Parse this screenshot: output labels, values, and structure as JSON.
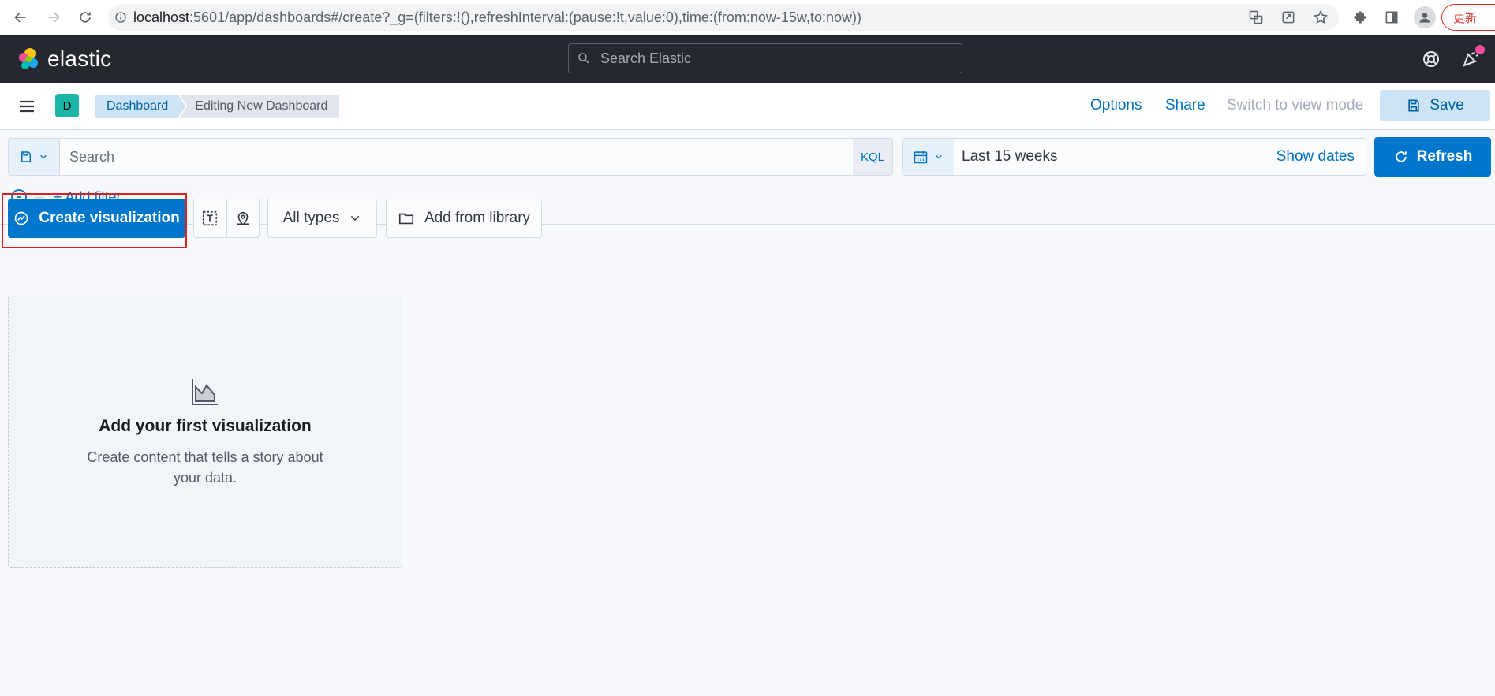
{
  "browser": {
    "url_host": "localhost",
    "url_rest": ":5601/app/dashboards#/create?_g=(filters:!(),refreshInterval:(pause:!t,value:0),time:(from:now-15w,to:now))",
    "update_label": "更新"
  },
  "header": {
    "logo_text": "elastic",
    "search_placeholder": "Search Elastic"
  },
  "app_header": {
    "space_initial": "D",
    "breadcrumbs": [
      "Dashboard",
      "Editing New Dashboard"
    ],
    "options_label": "Options",
    "share_label": "Share",
    "switch_label": "Switch to view mode",
    "save_label": "Save"
  },
  "query": {
    "search_placeholder": "Search",
    "language": "KQL",
    "time_range": "Last 15 weeks",
    "show_dates_label": "Show dates",
    "refresh_label": "Refresh",
    "add_filter_label": "+ Add filter"
  },
  "toolbar": {
    "create_label": "Create visualization",
    "all_types_label": "All types",
    "library_label": "Add from library"
  },
  "empty_panel": {
    "title": "Add your first visualization",
    "description": "Create content that tells a story about your data."
  },
  "colors": {
    "primary": "#0077cc",
    "header_bg": "#25282f",
    "highlight": "#e02020"
  }
}
